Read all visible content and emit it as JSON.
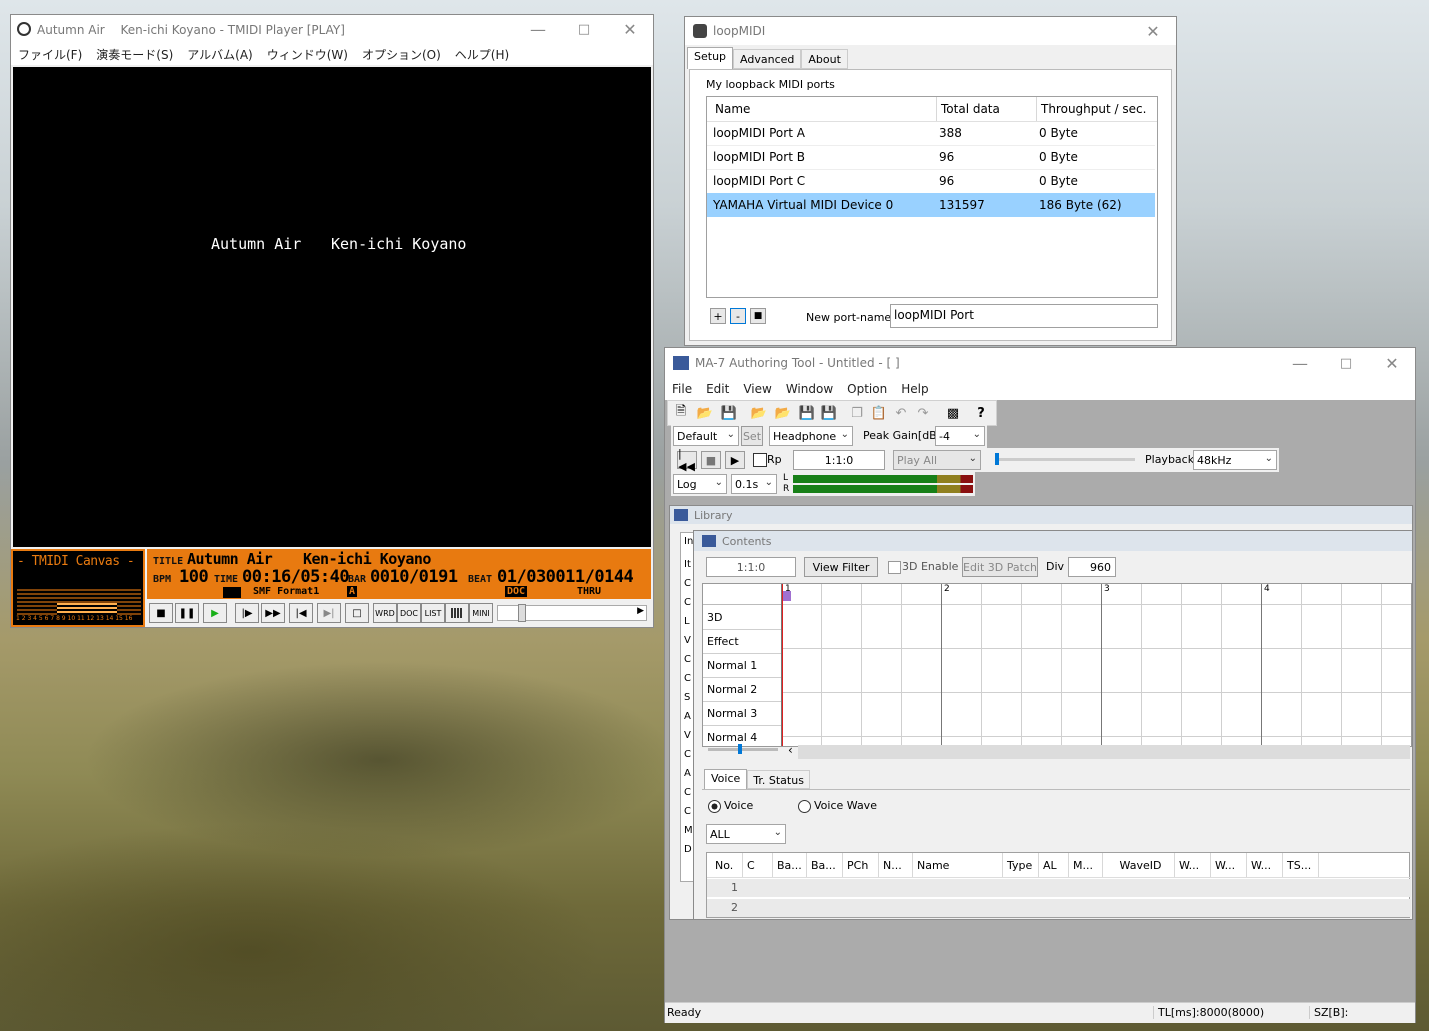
{
  "tmidi": {
    "title": "Autumn Air　 Ken-ichi Koyano - TMIDI Player [PLAY]",
    "menu": [
      "ファイル(F)",
      "演奏モード(S)",
      "アルバム(A)",
      "ウィンドウ(W)",
      "オプション(O)",
      "ヘルプ(H)"
    ],
    "display_song": "Autumn Air",
    "display_artist": "Ken-ichi Koyano",
    "canvas_label": "- TMIDI Canvas -",
    "channel_numbers": "1 2 3 4 5 6 7 8 9 10 11 12 13 14 15 16",
    "title_label": "TITLE",
    "title_value": "Autumn Air",
    "artist_value": "Ken-ichi Koyano",
    "bpm_label": "BPM",
    "bpm_value": "100",
    "time_label": "TIME",
    "time_value": "00:16/05:40",
    "bar_label": "BAR",
    "bar_value": "0010/0191",
    "beat_label": "BEAT",
    "beat_value": "01/030011/0144",
    "format_value": "SMF Format1",
    "port_a": "A",
    "doc_label": "DOC",
    "thru_label": "THRU",
    "mode_buttons": [
      "WRD",
      "DOC",
      "LIST",
      "",
      "MINI"
    ]
  },
  "loopmidi": {
    "title": "loopMIDI",
    "tabs": [
      "Setup",
      "Advanced",
      "About"
    ],
    "group_label": "My loopback MIDI ports",
    "columns": [
      "Name",
      "Total data",
      "Throughput / sec."
    ],
    "rows": [
      {
        "name": "loopMIDI Port A",
        "total": "388",
        "throughput": "0 Byte"
      },
      {
        "name": "loopMIDI Port B",
        "total": "96",
        "throughput": "0 Byte"
      },
      {
        "name": "loopMIDI Port C",
        "total": "96",
        "throughput": "0 Byte"
      },
      {
        "name": "YAMAHA Virtual MIDI Device 0",
        "total": "131597",
        "throughput": "186 Byte (62)"
      }
    ],
    "add": "+",
    "remove": "-",
    "stop": "■",
    "new_port_label": "New port-name:",
    "new_port_value": "loopMIDI Port"
  },
  "ma7": {
    "title": "MA-7 Authoring Tool - Untitled - [ ]",
    "menu": [
      "File",
      "Edit",
      "View",
      "Window",
      "Option",
      "Help"
    ],
    "preset": "Default",
    "set_label": "Set",
    "output": "Headphone",
    "peak_gain_label": "Peak Gain[dB]",
    "peak_gain": "-4",
    "rp_label": "Rp",
    "position": "1:1:0",
    "play_mode": "Play All",
    "playback_label": "Playback",
    "sample_rate": "48kHz",
    "scale": "Log",
    "interval": "0.1s",
    "meter_l": "L",
    "meter_r": "R",
    "library_title": "Library",
    "library_side": [
      "In",
      "It",
      "C",
      "C",
      "L",
      "V",
      "C",
      "C",
      "S",
      "A",
      "V",
      "C",
      "A",
      "C",
      "C",
      "M",
      "D"
    ],
    "contents_title": "Contents",
    "contents_position": "1:1:0",
    "view_filter": "View Filter",
    "enable_3d": "3D Enable",
    "edit_3d_patch": "Edit 3D Patch",
    "div_label": "Div",
    "div_value": "960",
    "measures": [
      "1",
      "2",
      "3",
      "4"
    ],
    "tracks": [
      "3D",
      "Effect",
      "Normal 1",
      "Normal 2",
      "Normal 3",
      "Normal 4"
    ],
    "bottom_tabs": [
      "Voice",
      "Tr. Status"
    ],
    "radio_voice": "Voice",
    "radio_wave": "Voice Wave",
    "filter": "ALL",
    "voice_columns": [
      "No.",
      "C",
      "Ba...",
      "Ba...",
      "PCh",
      "N...",
      "Name",
      "Type",
      "AL",
      "M...",
      "WaveID",
      "W...",
      "W...",
      "W...",
      "TS..."
    ],
    "voice_rows": [
      "1",
      "2"
    ],
    "status_ready": "Ready",
    "status_tl": "TL[ms]:8000(8000)",
    "status_sz": "SZ[B]:"
  }
}
